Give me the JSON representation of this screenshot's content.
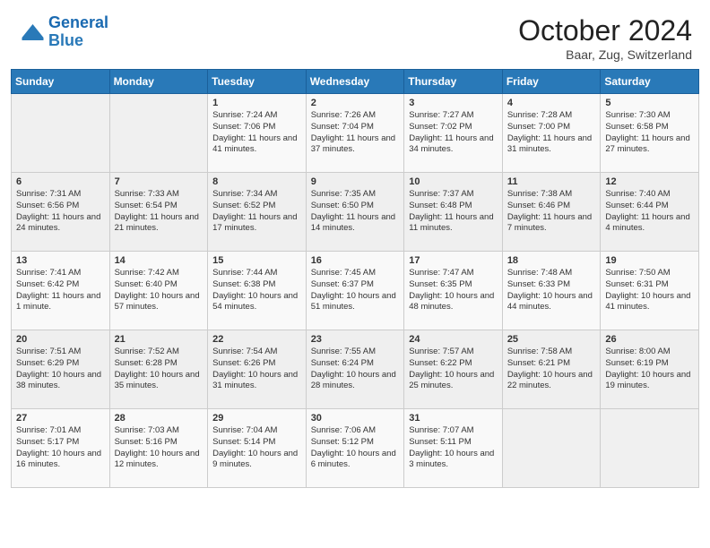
{
  "header": {
    "logo_general": "General",
    "logo_blue": "Blue",
    "month_title": "October 2024",
    "location": "Baar, Zug, Switzerland"
  },
  "days_of_week": [
    "Sunday",
    "Monday",
    "Tuesday",
    "Wednesday",
    "Thursday",
    "Friday",
    "Saturday"
  ],
  "weeks": [
    [
      {
        "day": "",
        "info": ""
      },
      {
        "day": "",
        "info": ""
      },
      {
        "day": "1",
        "info": "Sunrise: 7:24 AM\nSunset: 7:06 PM\nDaylight: 11 hours\nand 41 minutes."
      },
      {
        "day": "2",
        "info": "Sunrise: 7:26 AM\nSunset: 7:04 PM\nDaylight: 11 hours\nand 37 minutes."
      },
      {
        "day": "3",
        "info": "Sunrise: 7:27 AM\nSunset: 7:02 PM\nDaylight: 11 hours\nand 34 minutes."
      },
      {
        "day": "4",
        "info": "Sunrise: 7:28 AM\nSunset: 7:00 PM\nDaylight: 11 hours\nand 31 minutes."
      },
      {
        "day": "5",
        "info": "Sunrise: 7:30 AM\nSunset: 6:58 PM\nDaylight: 11 hours\nand 27 minutes."
      }
    ],
    [
      {
        "day": "6",
        "info": "Sunrise: 7:31 AM\nSunset: 6:56 PM\nDaylight: 11 hours\nand 24 minutes."
      },
      {
        "day": "7",
        "info": "Sunrise: 7:33 AM\nSunset: 6:54 PM\nDaylight: 11 hours\nand 21 minutes."
      },
      {
        "day": "8",
        "info": "Sunrise: 7:34 AM\nSunset: 6:52 PM\nDaylight: 11 hours\nand 17 minutes."
      },
      {
        "day": "9",
        "info": "Sunrise: 7:35 AM\nSunset: 6:50 PM\nDaylight: 11 hours\nand 14 minutes."
      },
      {
        "day": "10",
        "info": "Sunrise: 7:37 AM\nSunset: 6:48 PM\nDaylight: 11 hours\nand 11 minutes."
      },
      {
        "day": "11",
        "info": "Sunrise: 7:38 AM\nSunset: 6:46 PM\nDaylight: 11 hours\nand 7 minutes."
      },
      {
        "day": "12",
        "info": "Sunrise: 7:40 AM\nSunset: 6:44 PM\nDaylight: 11 hours\nand 4 minutes."
      }
    ],
    [
      {
        "day": "13",
        "info": "Sunrise: 7:41 AM\nSunset: 6:42 PM\nDaylight: 11 hours\nand 1 minute."
      },
      {
        "day": "14",
        "info": "Sunrise: 7:42 AM\nSunset: 6:40 PM\nDaylight: 10 hours\nand 57 minutes."
      },
      {
        "day": "15",
        "info": "Sunrise: 7:44 AM\nSunset: 6:38 PM\nDaylight: 10 hours\nand 54 minutes."
      },
      {
        "day": "16",
        "info": "Sunrise: 7:45 AM\nSunset: 6:37 PM\nDaylight: 10 hours\nand 51 minutes."
      },
      {
        "day": "17",
        "info": "Sunrise: 7:47 AM\nSunset: 6:35 PM\nDaylight: 10 hours\nand 48 minutes."
      },
      {
        "day": "18",
        "info": "Sunrise: 7:48 AM\nSunset: 6:33 PM\nDaylight: 10 hours\nand 44 minutes."
      },
      {
        "day": "19",
        "info": "Sunrise: 7:50 AM\nSunset: 6:31 PM\nDaylight: 10 hours\nand 41 minutes."
      }
    ],
    [
      {
        "day": "20",
        "info": "Sunrise: 7:51 AM\nSunset: 6:29 PM\nDaylight: 10 hours\nand 38 minutes."
      },
      {
        "day": "21",
        "info": "Sunrise: 7:52 AM\nSunset: 6:28 PM\nDaylight: 10 hours\nand 35 minutes."
      },
      {
        "day": "22",
        "info": "Sunrise: 7:54 AM\nSunset: 6:26 PM\nDaylight: 10 hours\nand 31 minutes."
      },
      {
        "day": "23",
        "info": "Sunrise: 7:55 AM\nSunset: 6:24 PM\nDaylight: 10 hours\nand 28 minutes."
      },
      {
        "day": "24",
        "info": "Sunrise: 7:57 AM\nSunset: 6:22 PM\nDaylight: 10 hours\nand 25 minutes."
      },
      {
        "day": "25",
        "info": "Sunrise: 7:58 AM\nSunset: 6:21 PM\nDaylight: 10 hours\nand 22 minutes."
      },
      {
        "day": "26",
        "info": "Sunrise: 8:00 AM\nSunset: 6:19 PM\nDaylight: 10 hours\nand 19 minutes."
      }
    ],
    [
      {
        "day": "27",
        "info": "Sunrise: 7:01 AM\nSunset: 5:17 PM\nDaylight: 10 hours\nand 16 minutes."
      },
      {
        "day": "28",
        "info": "Sunrise: 7:03 AM\nSunset: 5:16 PM\nDaylight: 10 hours\nand 12 minutes."
      },
      {
        "day": "29",
        "info": "Sunrise: 7:04 AM\nSunset: 5:14 PM\nDaylight: 10 hours\nand 9 minutes."
      },
      {
        "day": "30",
        "info": "Sunrise: 7:06 AM\nSunset: 5:12 PM\nDaylight: 10 hours\nand 6 minutes."
      },
      {
        "day": "31",
        "info": "Sunrise: 7:07 AM\nSunset: 5:11 PM\nDaylight: 10 hours\nand 3 minutes."
      },
      {
        "day": "",
        "info": ""
      },
      {
        "day": "",
        "info": ""
      }
    ]
  ]
}
